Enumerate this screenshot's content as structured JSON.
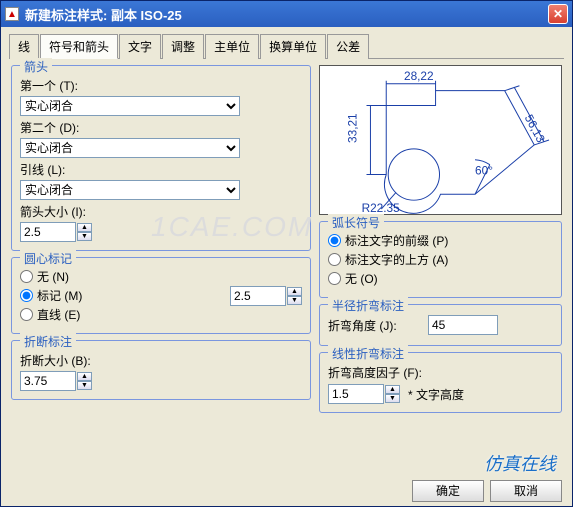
{
  "titlebar": {
    "title": "新建标注样式: 副本 ISO-25"
  },
  "tabs": [
    "线",
    "符号和箭头",
    "文字",
    "调整",
    "主单位",
    "换算单位",
    "公差"
  ],
  "active_tab_index": 1,
  "arrows": {
    "title": "箭头",
    "first_label": "第一个 (T):",
    "first_value": "实心闭合",
    "second_label": "第二个 (D):",
    "second_value": "实心闭合",
    "leader_label": "引线 (L):",
    "leader_value": "实心闭合",
    "size_label": "箭头大小 (I):",
    "size_value": "2.5"
  },
  "center": {
    "title": "圆心标记",
    "opts": {
      "none": "无 (N)",
      "mark": "标记 (M)",
      "line": "直线 (E)"
    },
    "selected": "mark",
    "value": "2.5"
  },
  "break": {
    "title": "折断标注",
    "size_label": "折断大小 (B):",
    "size_value": "3.75"
  },
  "arc": {
    "title": "弧长符号",
    "opts": {
      "before": "标注文字的前缀 (P)",
      "above": "标注文字的上方 (A)",
      "none": "无 (O)"
    },
    "selected": "before"
  },
  "radjog": {
    "title": "半径折弯标注",
    "angle_label": "折弯角度 (J):",
    "angle_value": "45"
  },
  "linjog": {
    "title": "线性折弯标注",
    "factor_label": "折弯高度因子 (F):",
    "factor_value": "1.5",
    "suffix": "* 文字高度"
  },
  "preview": {
    "dim_top": "28,22",
    "dim_left": "33,21",
    "dim_diag": "56,13",
    "dim_r": "R22.35",
    "dim_ang": "60°"
  },
  "buttons": {
    "ok": "确定",
    "cancel": "取消"
  },
  "watermark_center": "1CAE.COM",
  "watermark_br": "仿真在线"
}
